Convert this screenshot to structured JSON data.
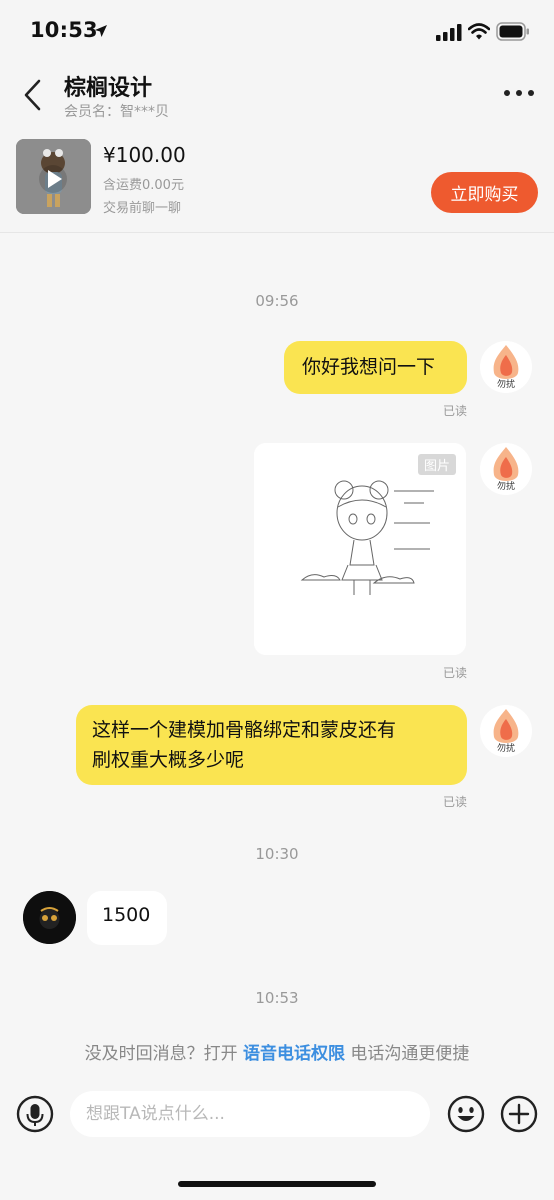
{
  "status_bar": {
    "time": "10:53"
  },
  "header": {
    "title": "棕榈设计",
    "member": "会员名：智***贝"
  },
  "product": {
    "price": "¥100.00",
    "shipping": "含运费0.00元",
    "pre_chat": "交易前聊一聊",
    "buy_label": "立即购买"
  },
  "chat": {
    "time1": "09:56",
    "msg1": "你好我想问一下",
    "read1": "已读",
    "image_tag": "图片",
    "read2": "已读",
    "msg3_line1": "这样一个建模加骨骼绑定和蒙皮还有",
    "msg3_line2": "刷权重大概多少呢",
    "read3": "已读",
    "time2": "10:30",
    "reply": "1500",
    "time3": "10:53",
    "avatar_tag": "勿扰"
  },
  "notice": {
    "prefix": "没及时回消息？打开 ",
    "link": "语音电话权限",
    "suffix": " 电话沟通更便捷"
  },
  "input": {
    "placeholder": "想跟TA说点什么..."
  },
  "colors": {
    "accent_yellow": "#fae451",
    "buy_orange": "#ee5a2f",
    "link_blue": "#3d8fe0",
    "background": "#f6f6f6"
  }
}
